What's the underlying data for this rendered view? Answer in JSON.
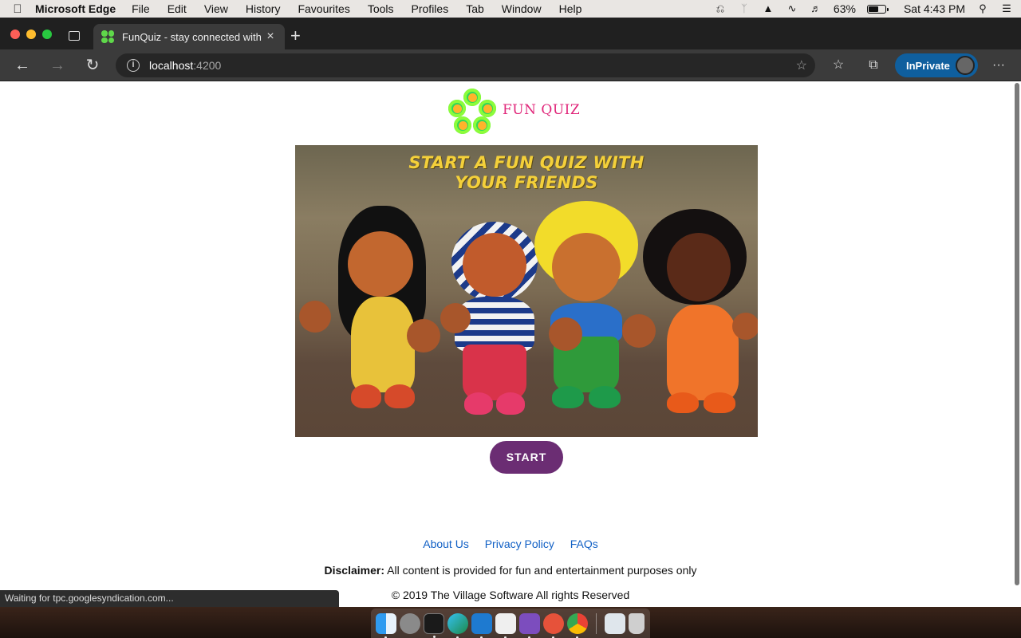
{
  "menubar": {
    "apple": "",
    "items": [
      "Microsoft Edge",
      "File",
      "Edit",
      "View",
      "History",
      "Favourites",
      "Tools",
      "Profiles",
      "Tab",
      "Window",
      "Help"
    ],
    "battery_percent": "63%",
    "battery_level": 0.63,
    "clock": "Sat 4:43 PM"
  },
  "browser": {
    "tab_title": "FunQuiz - stay connected with",
    "tab_close": "×",
    "new_tab": "+",
    "url_host": "localhost",
    "url_port": ":4200",
    "inprivate_label": "InPrivate",
    "more": "···",
    "back": "←",
    "forward": "→",
    "reload": "↻",
    "info": "i"
  },
  "page": {
    "logo_text": "FUN QUIZ",
    "hero_headline_line1": "START A FUN QUIZ WITH",
    "hero_headline_line2": "YOUR FRIENDS",
    "start_button": "START",
    "footer_links": [
      "About Us",
      "Privacy Policy",
      "FAQs"
    ],
    "disclaimer_label": "Disclaimer:",
    "disclaimer_text": " All content is provided for fun and entertainment purposes only",
    "copyright": "© 2019 The Village Software All rights Reserved"
  },
  "status_text": "Waiting for tpc.googlesyndication.com...",
  "colors": {
    "accent_button": "#6b2d73",
    "link": "#1160c5",
    "logo_text": "#e0267a",
    "headline": "#f4d03a"
  },
  "icons": {
    "menubar_right": [
      "vpn-icon",
      "bluetooth-icon",
      "turtle-icon",
      "wifi-icon",
      "volume-icon",
      "battery-icon",
      "search-icon",
      "control-center-icon"
    ],
    "dock": [
      "finder-icon",
      "launchpad-icon",
      "terminal-icon",
      "edge-icon",
      "vscode-icon",
      "app-icon",
      "visual-studio-icon",
      "git-client-icon",
      "chrome-icon",
      "preview-icon",
      "trash-icon"
    ]
  }
}
